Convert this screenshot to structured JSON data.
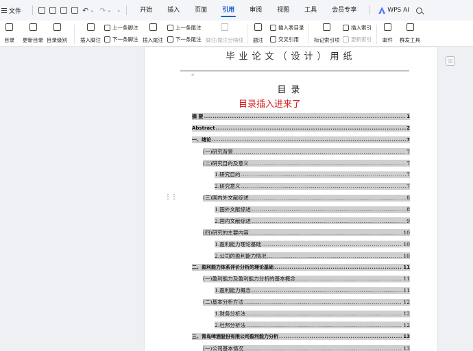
{
  "menubar": {
    "file_label": "文件",
    "tabs": [
      "开始",
      "插入",
      "页面",
      "引用",
      "审阅",
      "视图",
      "工具",
      "会员专享"
    ],
    "active_tab": "引用",
    "ai_label": "WPS AI"
  },
  "ribbon": {
    "toc": "目录",
    "update_toc": "更新目录",
    "toc_level": "目录级别",
    "insert_footnote": "插入脚注",
    "prev_footnote": "上一条脚注",
    "next_footnote": "下一条脚注",
    "insert_endnote": "插入尾注",
    "prev_endnote": "上一条尾注",
    "next_endnote": "下一条尾注",
    "separator": "脚注/尾注分隔线",
    "caption": "题注",
    "insert_table_of_figures": "插入表目录",
    "cross_reference": "交叉引用",
    "mark_index": "标记索引项",
    "insert_index": "插入索引",
    "update_index": "更新索引",
    "mail": "邮件",
    "mass_tools": "群发工具"
  },
  "page": {
    "header": "毕业论文（设计）用纸",
    "toc_title": "目录",
    "inserted_note": "目录插入进来了"
  },
  "toc": [
    {
      "text": "摘    要",
      "page": "1",
      "level": 1,
      "bold": true
    },
    {
      "text": "Abstract",
      "page": "2",
      "level": 1,
      "bold": true
    },
    {
      "text": "一、绪论",
      "page": "7",
      "level": 1,
      "bold": true
    },
    {
      "text": "(一)研究背景",
      "page": "7",
      "level": 2,
      "bold": false
    },
    {
      "text": "(二)研究目的及意义",
      "page": "7",
      "level": 2,
      "bold": false
    },
    {
      "text": "1.研究目的",
      "page": "7",
      "level": 3,
      "bold": false
    },
    {
      "text": "2.研究意义",
      "page": "7",
      "level": 3,
      "bold": false
    },
    {
      "text": "(三)国内外文献综述",
      "page": "8",
      "level": 2,
      "bold": false
    },
    {
      "text": "1.国外文献综述",
      "page": "8",
      "level": 3,
      "bold": false
    },
    {
      "text": "2.国内文献综述",
      "page": "9",
      "level": 3,
      "bold": false
    },
    {
      "text": "(四)研究的主要内容",
      "page": "10",
      "level": 2,
      "bold": false
    },
    {
      "text": "1.盈利能力理论基础",
      "page": "10",
      "level": 3,
      "bold": false
    },
    {
      "text": "2.公司的盈利能力情况",
      "page": "10",
      "level": 3,
      "bold": false
    },
    {
      "text": "二、盈利能力体系评价分析的理论基础",
      "page": "11",
      "level": 1,
      "bold": true
    },
    {
      "text": "(一)盈利能力及盈利能力分析的基本概念",
      "page": "11",
      "level": 2,
      "bold": false
    },
    {
      "text": "1.盈利能力概念",
      "page": "11",
      "level": 3,
      "bold": false
    },
    {
      "text": "(二)基本分析方法",
      "page": "12",
      "level": 2,
      "bold": false
    },
    {
      "text": "1.财务分析法",
      "page": "12",
      "level": 3,
      "bold": false
    },
    {
      "text": "2.杜邦分析法",
      "page": "12",
      "level": 3,
      "bold": false
    },
    {
      "text": "三、青岛啤酒股份有限公司盈利能力分析",
      "page": "13",
      "level": 1,
      "bold": true
    },
    {
      "text": "(一)公司基本情况",
      "page": "13",
      "level": 2,
      "bold": false
    }
  ]
}
